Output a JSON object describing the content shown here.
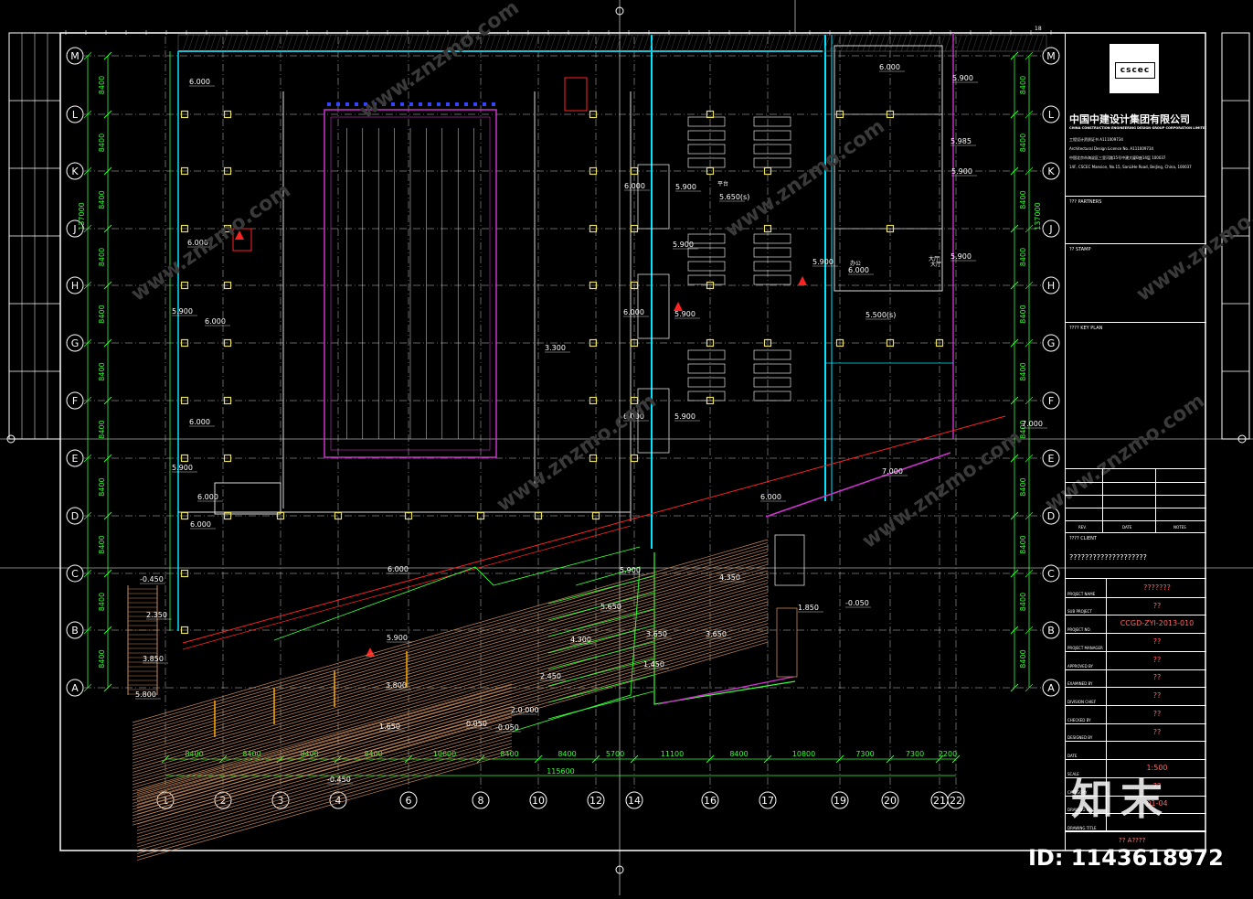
{
  "colors": {
    "background": "#000000",
    "frame": "#ffffff",
    "grid": "#c8c8c8",
    "dimension": "#33ff33",
    "column": "#e8e060",
    "wall_cyan": "#00e5ff",
    "pool": "#cc33cc",
    "red": "#ff2222",
    "stairs": "#c88a5a",
    "watermark": "#3a3a3a"
  },
  "grid": {
    "row_labels": [
      "M",
      "L",
      "K",
      "J",
      "H",
      "G",
      "F",
      "E",
      "D",
      "C",
      "B",
      "A"
    ],
    "column_labels": [
      "1",
      "2",
      "3",
      "4",
      "6",
      "8",
      "10",
      "12",
      "14",
      "16",
      "17",
      "19",
      "20",
      "21",
      "22"
    ],
    "left_dims": [
      "8400",
      "8400",
      "8400",
      "8400",
      "8400",
      "8400",
      "8400",
      "8400",
      "8400",
      "8400",
      "8400"
    ],
    "left_total": "137000",
    "right_dims": [
      "8400",
      "8400",
      "8400",
      "8400",
      "8400",
      "8400",
      "8400",
      "8400",
      "8400",
      "8400",
      "8400"
    ],
    "right_total": "137000",
    "bottom_dims": [
      "8400",
      "8400",
      "8400",
      "8400",
      "10600",
      "8400",
      "8400",
      "5700",
      "11100",
      "8400",
      "10800",
      "7300",
      "7300",
      "2200"
    ],
    "bottom_total": "115600",
    "top_number": "18"
  },
  "elevations": [
    {
      "t": "6.000"
    },
    {
      "t": "6.000"
    },
    {
      "t": "5.900"
    },
    {
      "t": "6.000"
    },
    {
      "t": "6.000"
    },
    {
      "t": "5.900"
    },
    {
      "t": "6.000"
    },
    {
      "t": "6.000"
    },
    {
      "t": "3.300"
    },
    {
      "t": "6.000"
    },
    {
      "t": "6.000"
    },
    {
      "t": "6.000"
    },
    {
      "t": "5.900"
    },
    {
      "t": "5.650(s)"
    },
    {
      "t": "5.900"
    },
    {
      "t": "5.900"
    },
    {
      "t": "5.900"
    },
    {
      "t": "6.000"
    },
    {
      "t": "5.900"
    },
    {
      "t": "5.985"
    },
    {
      "t": "5.900"
    },
    {
      "t": "6.000"
    },
    {
      "t": "5.900"
    },
    {
      "t": "5.500(s)"
    },
    {
      "t": "7.000"
    },
    {
      "t": "7.000"
    },
    {
      "t": "6.000"
    },
    {
      "t": "6.000"
    },
    {
      "t": "5.900"
    },
    {
      "t": "4.300"
    },
    {
      "t": "5.900"
    },
    {
      "t": "3.800"
    },
    {
      "t": "2.450"
    },
    {
      "t": "1.650"
    },
    {
      "t": "0.050"
    },
    {
      "t": "-0.050"
    },
    {
      "t": "2.0.000"
    },
    {
      "t": "3.650"
    },
    {
      "t": "3.650"
    },
    {
      "t": "1.450"
    },
    {
      "t": "1.850"
    },
    {
      "t": "-0.050"
    },
    {
      "t": "-0.450"
    },
    {
      "t": "2.350"
    },
    {
      "t": "3.850"
    },
    {
      "t": "5.800"
    },
    {
      "t": "-0.450"
    },
    {
      "t": "5.650"
    },
    {
      "t": "4.350"
    },
    {
      "t": "5.900"
    }
  ],
  "room_labels": [
    "平台",
    "大厅",
    "办公",
    "大厅"
  ],
  "title_block": {
    "logo_text": "cscec",
    "company_cn": "中国中建设计集团有限公司",
    "company_en": "CHINA CONSTRUCTION ENGINEERING DESIGN GROUP CORPORATION LIMITED",
    "licence_lines": [
      "工程设计资质证书 A111009734",
      "Architectural Design Licence No. A111009734",
      "中国北京市海淀区三里河路15号中建大厦B座14层  100037",
      "14F, CSCEC Mansion, No.15, SanLiHe Road, BeiJing, China, 100037"
    ],
    "partners_label": "??? PARTNERS",
    "stamp_label": "?? STAMP",
    "key_plan_label": "???? KEY PLAN",
    "rev_label": "REV.",
    "date_label": "DATE",
    "notes_label": "NOTES",
    "client_label": "???? CLIENT",
    "client_value": "????????????????????",
    "rows": [
      {
        "label": "PROJECT NAME",
        "value": "???????"
      },
      {
        "label": "SUB PROJECT",
        "value": "??"
      },
      {
        "label": "PROJECT NO.",
        "value": "CCGD-ZYI-2013-010"
      },
      {
        "label": "PROJECT MANAGER",
        "value": "??"
      },
      {
        "label": "APPROVED BY",
        "value": "??"
      },
      {
        "label": "EXAMINED BY",
        "value": "??"
      },
      {
        "label": "DIVISION CHIEF",
        "value": "??"
      },
      {
        "label": "CHECKED BY",
        "value": "??"
      },
      {
        "label": "DESIGNED BY",
        "value": "??"
      },
      {
        "label": "DATE",
        "value": ""
      },
      {
        "label": "SCALE",
        "value": "1:500"
      },
      {
        "label": "CATEGORY",
        "value": "??"
      },
      {
        "label": "DRAWING NO.",
        "value": "01-04"
      },
      {
        "label": "DRAWING TITLE",
        "value": ""
      }
    ],
    "footer_value": "?? A????"
  },
  "watermark": {
    "brand_cn": "知末",
    "site": "www.znzmo.com",
    "id_text": "ID: 1143618972"
  }
}
